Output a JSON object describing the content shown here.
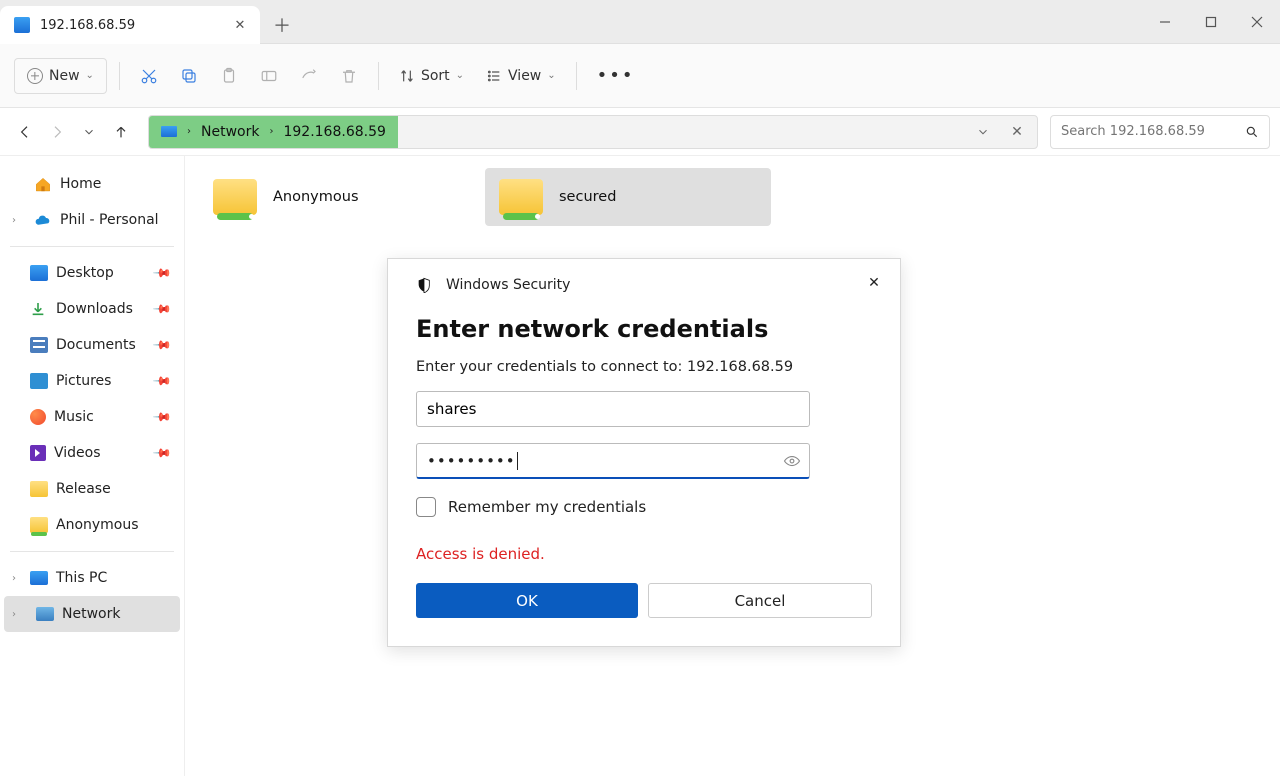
{
  "tab": {
    "title": "192.168.68.59"
  },
  "toolbar": {
    "new_label": "New",
    "sort_label": "Sort",
    "view_label": "View"
  },
  "address": {
    "crumb1": "Network",
    "crumb2": "192.168.68.59"
  },
  "search": {
    "placeholder": "Search 192.168.68.59"
  },
  "sidebar": {
    "home": "Home",
    "phil": "Phil - Personal",
    "desktop": "Desktop",
    "downloads": "Downloads",
    "documents": "Documents",
    "pictures": "Pictures",
    "music": "Music",
    "videos": "Videos",
    "release": "Release",
    "anonymous": "Anonymous",
    "thispc": "This PC",
    "network": "Network"
  },
  "folders": [
    {
      "name": "Anonymous"
    },
    {
      "name": "secured"
    }
  ],
  "dialog": {
    "app": "Windows Security",
    "title": "Enter network credentials",
    "subtitle": "Enter your credentials to connect to: 192.168.68.59",
    "username": "shares",
    "password_mask": "•••••••••",
    "remember": "Remember my credentials",
    "error": "Access is denied.",
    "ok": "OK",
    "cancel": "Cancel"
  }
}
